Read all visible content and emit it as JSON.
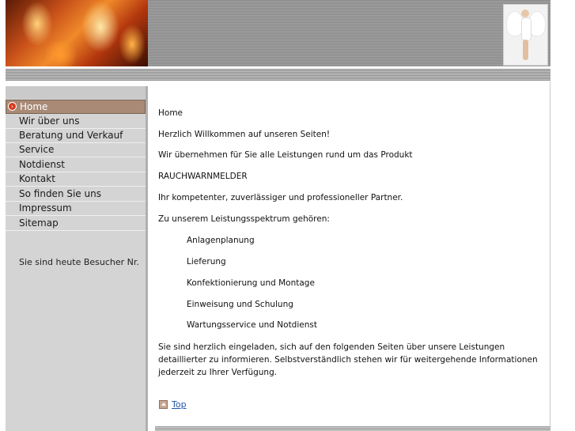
{
  "header": {
    "flame_image": "flames-banner",
    "angel_image": "angel-figure"
  },
  "sidebar": {
    "items": [
      {
        "label": "Home",
        "active": true
      },
      {
        "label": "Wir über uns"
      },
      {
        "label": "Beratung und Verkauf"
      },
      {
        "label": "Service"
      },
      {
        "label": "Notdienst"
      },
      {
        "label": "Kontakt"
      },
      {
        "label": "So finden Sie uns"
      },
      {
        "label": "Impressum"
      },
      {
        "label": "Sitemap"
      }
    ],
    "visitor_text": "Sie sind heute Besucher Nr."
  },
  "main": {
    "page_heading": "Home",
    "welcome": "Herzlich Willkommen auf unseren Seiten!",
    "services_intro": "Wir übernehmen für Sie alle Leistungen rund um das Produkt",
    "product": "RAUCHWARNMELDER",
    "partner": "Ihr kompetenter, zuverlässiger und professioneller Partner.",
    "spectrum_intro": "Zu unserem Leistungsspektrum gehören:",
    "services": [
      "Anlagenplanung",
      "Lieferung",
      "Konfektionierung und Montage",
      "Einweisung und Schulung",
      "Wartungsservice und Notdienst"
    ],
    "closing": "Sie sind herzlich eingeladen, sich auf den folgenden Seiten über unsere Leistungen detaillierter zu informieren. Selbstverständlich stehen wir für weitergehende Informationen jederzeit zu Ihrer Verfügung.",
    "top_link": "Top"
  },
  "colors": {
    "active_nav_bg": "#a88a77",
    "sidebar_bg": "#d4d4d4",
    "link": "#2255aa",
    "bullet": "#d6391c"
  }
}
